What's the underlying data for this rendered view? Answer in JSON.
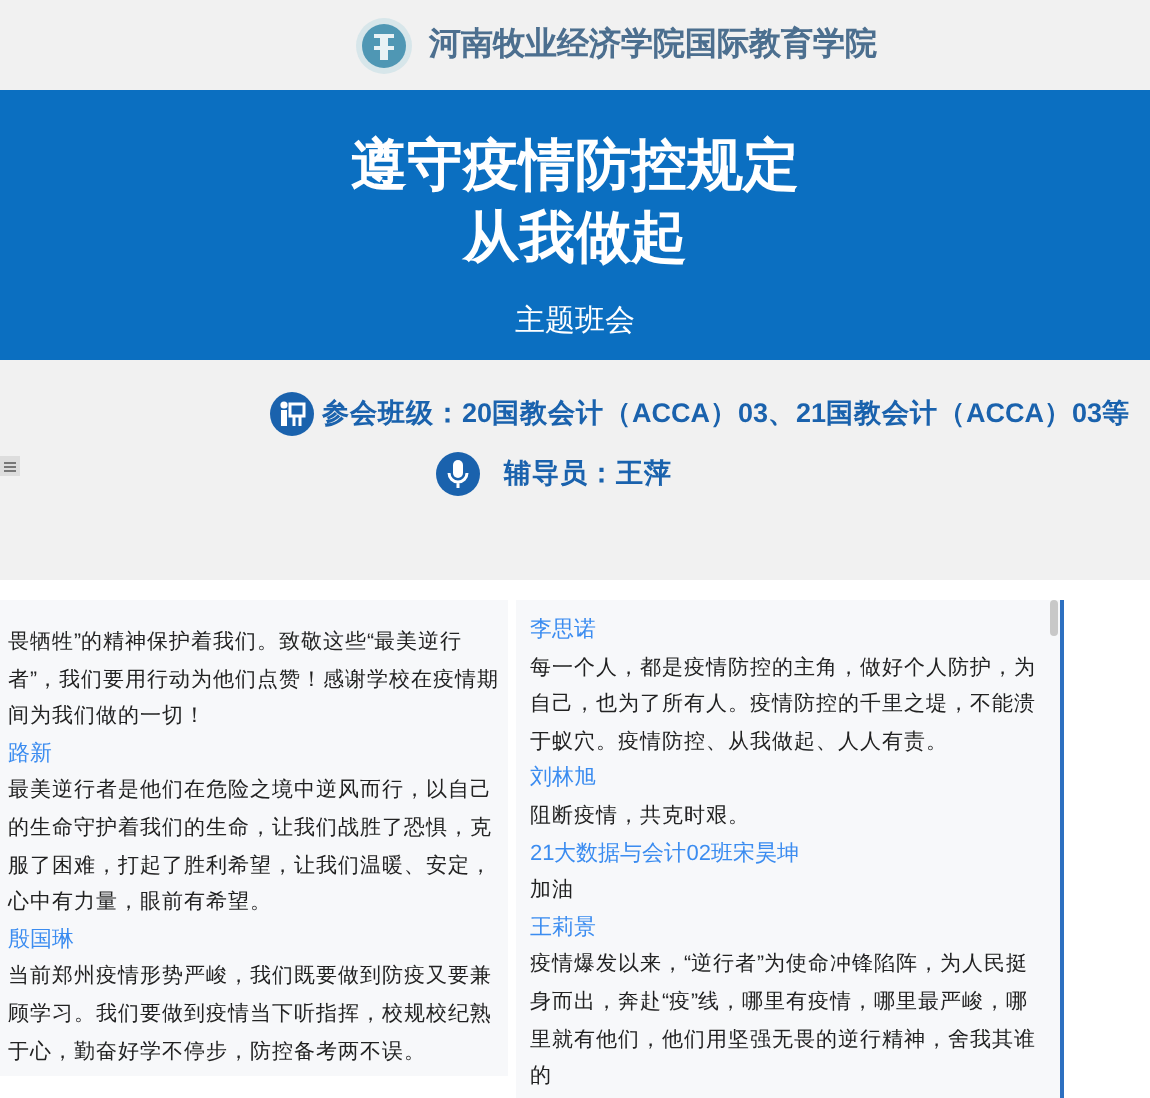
{
  "header": {
    "school": "河南牧业经济学院国际教育学院"
  },
  "slide": {
    "title_lines": [
      "遵守疫情防控规定",
      "从我做起"
    ],
    "subtitle": "主题班会",
    "info": [
      {
        "kind": "class",
        "text": "参会班级：20国教会计（ACCA）03、21国教会计（ACCA）03等"
      },
      {
        "kind": "advisor",
        "text": "辅导员：王萍"
      }
    ]
  },
  "comments": {
    "columns": [
      [
        {
          "text": "畏牺牲”的精神保护着我们。致敬这些“最美逆行者”，我们要用行动为他们点赞！感谢学校在疫情期间为我们做的一切！"
        },
        {
          "author": "路新",
          "text": "最美逆行者是他们在危险之境中逆风而行，以自己的生命守护着我们的生命，让我们战胜了恐惧，克服了困难，打起了胜利希望，让我们温暖、安定，心中有力量，眼前有希望。"
        },
        {
          "author": "殷国琳",
          "text": "当前郑州疫情形势严峻，我们既要做到防疫又要兼顾学习。我们要做到疫情当下听指挥，校规校纪熟于心，勤奋好学不停步，防控备考两不误。"
        }
      ],
      [
        {
          "author": "李思诺",
          "text": "每一个人，都是疫情防控的主角，做好个人防护，为自己，也为了所有人。疫情防控的千里之堤，不能溃于蚁穴。疫情防控、从我做起、人人有责。"
        },
        {
          "author": "刘林旭",
          "text": "阻断疫情，共克时艰。"
        },
        {
          "author": "21大数据与会计02班宋昊坤",
          "text": "加油"
        },
        {
          "author": "王莉景",
          "text": "疫情爆发以来，“逆行者”为使命冲锋陷阵，为人民挺身而出，奔赴“疫”线，哪里有疫情，哪里最严峻，哪里就有他们，他们用坚强无畏的逆行精神，舍我其谁的"
        }
      ]
    ]
  }
}
